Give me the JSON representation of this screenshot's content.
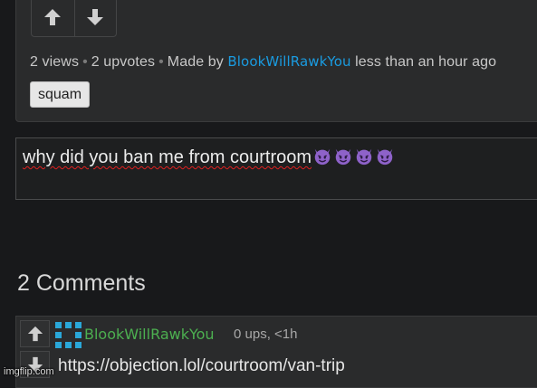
{
  "post": {
    "views": "2 views",
    "upvotes": "2 upvotes",
    "made_by_label": "Made by",
    "author": "BlookWillRawkYou",
    "time": "less than an hour ago",
    "tag": "squam"
  },
  "comment_input": {
    "value": "why did you ban me from courtroom",
    "emoji_icon": "smiling-imp-emoji",
    "emoji_count": 4
  },
  "comments": {
    "title": "2 Comments",
    "items": [
      {
        "user": "BlookWillRawkYou",
        "meta": "0 ups, <1h",
        "text": "https://objection.lol/courtroom/van-trip",
        "user_color": "#4caf50"
      }
    ]
  },
  "watermark": "imgflip.com",
  "colors": {
    "background": "#18191b",
    "card": "#2a2b2c",
    "author_link": "#1a9be0",
    "comment_user": "#4caf50"
  }
}
